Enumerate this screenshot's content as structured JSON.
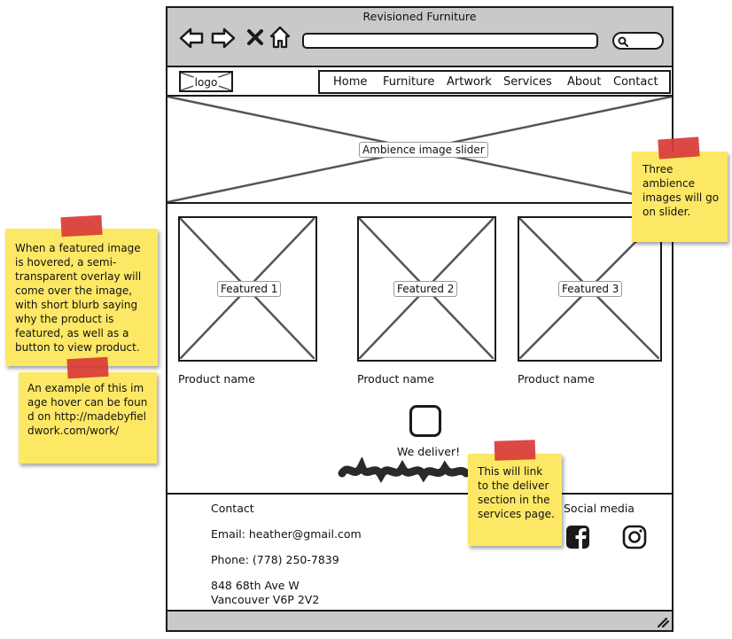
{
  "window": {
    "title": "Revisioned Furniture"
  },
  "toolbar": {
    "back_icon": "back-arrow-icon",
    "forward_icon": "forward-arrow-icon",
    "stop_icon": "close-x-icon",
    "home_icon": "home-icon",
    "search_icon": "search-icon"
  },
  "header": {
    "logo_label": "logo",
    "nav": [
      "Home",
      "Furniture",
      "Artwork",
      "Services",
      "About",
      "Contact"
    ]
  },
  "hero": {
    "label": "Ambience image slider"
  },
  "featured": [
    {
      "label": "Featured 1",
      "name": "Product name"
    },
    {
      "label": "Featured 2",
      "name": "Product name"
    },
    {
      "label": "Featured 3",
      "name": "Product name"
    }
  ],
  "delivery": {
    "label": "We deliver!"
  },
  "footer": {
    "contact_heading": "Contact",
    "email": "Email: heather@gmail.com",
    "phone": "Phone: (778) 250-7839",
    "address_line1": "848 68th Ave W",
    "address_line2": "Vancouver V6P 2V2",
    "social_heading": "Social media",
    "social_icons": [
      "facebook-icon",
      "instagram-icon"
    ]
  },
  "notes": {
    "slider": "Three ambience images will go on slider.",
    "hover": "When a featured image is hovered, a semi-transparent overlay will come over the image, with short blurb saying why the product is featured, as well as a button to view product.",
    "example": "An example of this image hover can be found on http://madebyfieldwork.com/work/",
    "deliver": "This will link to the deliver section in the services page."
  },
  "colors": {
    "chrome": "#c9c9c9",
    "sticky": "#fde866",
    "tape": "#d93a35",
    "ink": "#1a1a1a"
  }
}
